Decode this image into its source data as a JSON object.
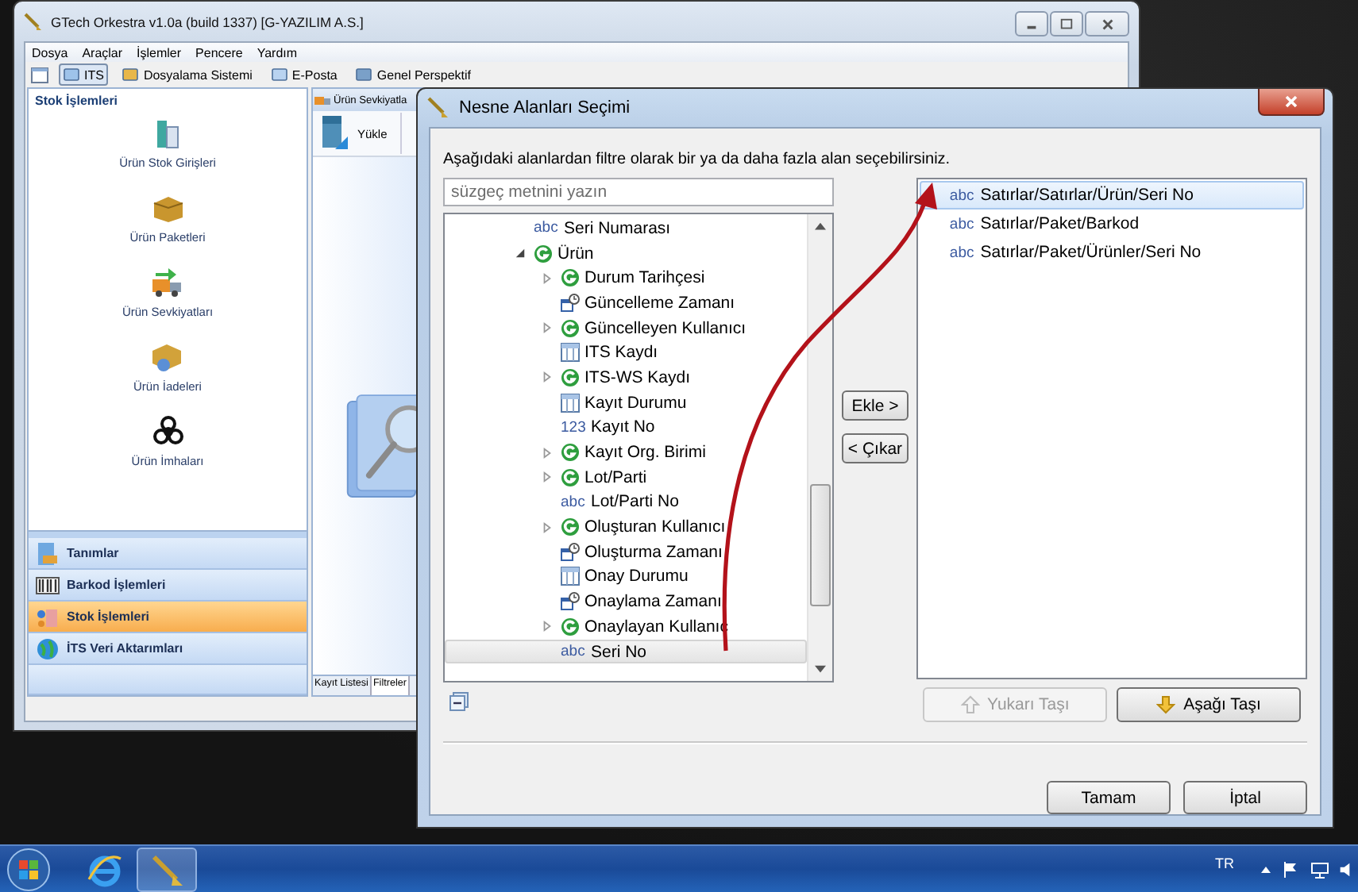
{
  "main_window": {
    "title": "GTech Orkestra v1.0a (build 1337) [G-YAZILIM A.S.]",
    "menu": [
      "Dosya",
      "Araçlar",
      "İşlemler",
      "Pencere",
      "Yardım"
    ],
    "toolbar": [
      {
        "label": "ITS",
        "selected": true
      },
      {
        "label": "Dosyalama Sistemi",
        "selected": false
      },
      {
        "label": "E-Posta",
        "selected": false
      },
      {
        "label": "Genel Perspektif",
        "selected": false
      }
    ],
    "sidebar": {
      "title": "Stok İşlemleri",
      "items": [
        "Ürün Stok Girişleri",
        "Ürün Paketleri",
        "Ürün Sevkiyatları",
        "Ürün İadeleri",
        "Ürün İmhaları"
      ],
      "sections": [
        {
          "label": "Tanımlar",
          "selected": false
        },
        {
          "label": "Barkod İşlemleri",
          "selected": false
        },
        {
          "label": "Stok İşlemleri",
          "selected": true
        },
        {
          "label": "İTS Veri Aktarımları",
          "selected": false
        }
      ]
    },
    "editor": {
      "tab": "Ürün Sevkiyatla",
      "toolbar_button": "Yükle",
      "bottom_tabs": [
        {
          "label": "Kayıt Listesi",
          "selected": false
        },
        {
          "label": "Filtreler",
          "selected": true
        }
      ]
    }
  },
  "dialog": {
    "title": "Nesne Alanları Seçimi",
    "instruction": "Aşağıdaki alanlardan filtre olarak bir ya da daha fazla alan seçebilirsiniz.",
    "filter": {
      "placeholder": "süzgeç metnini yazın"
    },
    "tree": [
      {
        "label": "Seri Numarası",
        "kind": "text",
        "type_label": "abc",
        "selected": false
      },
      {
        "label": "Ürün",
        "kind": "group",
        "expanded": true,
        "selected": false,
        "children": [
          {
            "label": "Durum Tarihçesi",
            "kind": "group",
            "expanded": false,
            "selected": false
          },
          {
            "label": "Güncelleme Zamanı",
            "kind": "date",
            "selected": false
          },
          {
            "label": "Güncelleyen Kullanıcı",
            "kind": "group",
            "expanded": false,
            "selected": false
          },
          {
            "label": "ITS Kaydı",
            "kind": "table",
            "selected": false
          },
          {
            "label": "ITS-WS Kaydı",
            "kind": "group",
            "expanded": false,
            "selected": false
          },
          {
            "label": "Kayıt Durumu",
            "kind": "table",
            "selected": false
          },
          {
            "label": "Kayıt No",
            "kind": "text",
            "type_label": "123",
            "selected": false
          },
          {
            "label": "Kayıt Org. Birimi",
            "kind": "group",
            "expanded": false,
            "selected": false
          },
          {
            "label": "Lot/Parti",
            "kind": "group",
            "expanded": false,
            "selected": false
          },
          {
            "label": "Lot/Parti No",
            "kind": "text",
            "type_label": "abc",
            "selected": false
          },
          {
            "label": "Oluşturan Kullanıcı",
            "kind": "group",
            "expanded": false,
            "selected": false
          },
          {
            "label": "Oluşturma Zamanı",
            "kind": "date",
            "selected": false
          },
          {
            "label": "Onay Durumu",
            "kind": "table",
            "selected": false
          },
          {
            "label": "Onaylama Zamanı",
            "kind": "date",
            "selected": false
          },
          {
            "label": "Onaylayan Kullanıc",
            "kind": "group",
            "expanded": false,
            "selected": false
          },
          {
            "label": "Seri No",
            "kind": "text",
            "type_label": "abc",
            "selected": true
          }
        ]
      }
    ],
    "add_button": "Ekle >",
    "remove_button": "< Çıkar",
    "selected_fields": [
      {
        "label": "Satırlar/Satırlar/Ürün/Seri No",
        "type_label": "abc",
        "selected": true
      },
      {
        "label": "Satırlar/Paket/Barkod",
        "type_label": "abc",
        "selected": false
      },
      {
        "label": "Satırlar/Paket/Ürünler/Seri No",
        "type_label": "abc",
        "selected": false
      }
    ],
    "move_buttons": [
      {
        "label": "Yukarı Taşı",
        "kind": "up",
        "disabled": true
      },
      {
        "label": "Aşağı Taşı",
        "kind": "down",
        "disabled": false
      }
    ],
    "ok_button": "Tamam",
    "cancel_button": "İptal"
  },
  "taskbar": {
    "language": "TR"
  }
}
